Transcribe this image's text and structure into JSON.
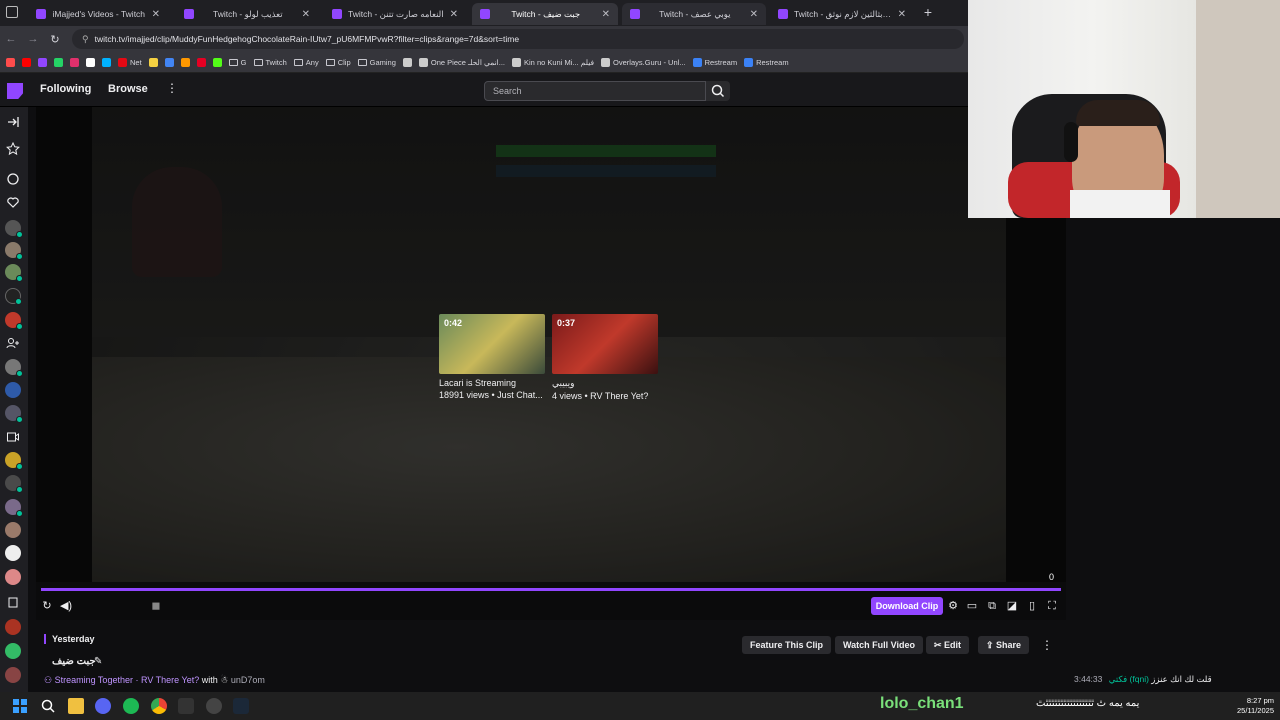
{
  "browser": {
    "tabs": [
      {
        "title": "iMajjed's Videos - Twitch",
        "active": false
      },
      {
        "title": "Twitch - تعذيب لولو",
        "active": false
      },
      {
        "title": "Twitch - النعامه صارت تتنن",
        "active": false
      },
      {
        "title": "Twitch - جبت ضيف",
        "active": true
      },
      {
        "title": "Twitch - يوبي عصف",
        "active": false
      },
      {
        "title": "Twitch - نحن بثالثين لازم نوثق",
        "active": false
      }
    ],
    "new_tab": "+",
    "url": "twitch.tv/imajjed/clip/MuddyFunHedgehogChocolateRain-IUtw7_pU6MFMPvwR?filter=clips&range=7d&sort=time",
    "bookmarks": [
      {
        "label": "",
        "color": "#ff4c4c"
      },
      {
        "label": "",
        "color": "#ff0000"
      },
      {
        "label": "",
        "color": "#9146ff"
      },
      {
        "label": "",
        "color": "#25d366"
      },
      {
        "label": "",
        "color": "#e1306c"
      },
      {
        "label": "",
        "color": "#ffffff"
      },
      {
        "label": "",
        "color": "#00b2ff"
      },
      {
        "label": "Net",
        "color": "#e50914"
      },
      {
        "label": "",
        "color": "#f5d142"
      },
      {
        "label": "",
        "color": "#4285f4"
      },
      {
        "label": "",
        "color": "#ff9800"
      },
      {
        "label": "",
        "color": "#e60023"
      },
      {
        "label": "",
        "color": "#53fc18"
      },
      {
        "label": "G",
        "folder": true
      },
      {
        "label": "Twitch",
        "folder": true
      },
      {
        "label": "Any",
        "folder": true
      },
      {
        "label": "Clip",
        "folder": true
      },
      {
        "label": "Gaming",
        "folder": true
      },
      {
        "label": "",
        "color": "#cccccc"
      },
      {
        "label": "One Piece انمي الحلـ...",
        "color": "#cccccc"
      },
      {
        "label": "Kin no Kuni Mi... فيلم",
        "color": "#cccccc"
      },
      {
        "label": "Overlays.Guru - Unl...",
        "color": "#cccccc"
      },
      {
        "label": "Restream",
        "color": "#3b82f6"
      },
      {
        "label": "Restream",
        "color": "#3b82f6"
      }
    ]
  },
  "twitch_nav": {
    "following": "Following",
    "browse": "Browse",
    "more": "⋮",
    "search_placeholder": "Search"
  },
  "player": {
    "recommendations": [
      {
        "duration": "0:42",
        "title": "Lacari is Streaming",
        "meta": "18991 views • Just Chat..."
      },
      {
        "duration": "0:37",
        "title": "ويبيبي",
        "meta": "4 views • RV There Yet?"
      }
    ],
    "progress_value": "0",
    "progress_fraction": 1.0,
    "download_label": "Download Clip"
  },
  "clip_info": {
    "date_label": "Yesterday",
    "title": "جبت ضيف",
    "stream_prefix": "Streaming Together",
    "game": "RV There Yet?",
    "with_label": "with",
    "with_user": "unD7om"
  },
  "actions": {
    "feature": "Feature This Clip",
    "watch_full": "Watch Full Video",
    "edit": "Edit",
    "share": "Share",
    "more": "⋮"
  },
  "chat": {
    "time": "3:44:33",
    "name": "فكتي",
    "handle": "(fqni)",
    "message": "قلت لك انك عنزز"
  },
  "taskbar": {
    "overlay_name": "lolo_chan1",
    "overlay_text": "يمه يمه ٿ ٿٿٿٿٿٿٿٿٿٿٿٿٿٿٿٿٿ",
    "time": "8:27 pm",
    "date": "25/11/2025"
  },
  "colors": {
    "twitch_purple": "#9146ff",
    "online_green": "#00c39a"
  }
}
